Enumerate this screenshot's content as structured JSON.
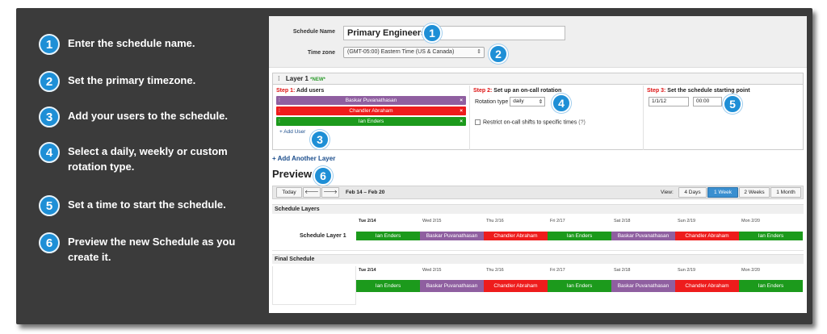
{
  "steps": [
    {
      "n": "1",
      "text": "Enter the schedule name."
    },
    {
      "n": "2",
      "text": "Set the primary timezone."
    },
    {
      "n": "3",
      "text": "Add your users to the schedule."
    },
    {
      "n": "4",
      "text": "Select a daily, weekly or custom rotation type."
    },
    {
      "n": "5",
      "text": "Set a time to start the schedule."
    },
    {
      "n": "6",
      "text": "Preview the new Schedule as you create it."
    }
  ],
  "form": {
    "schedule_name_label": "Schedule Name",
    "schedule_name_value": "Primary Engineers",
    "timezone_label": "Time zone",
    "timezone_value": "(GMT-05:00) Eastern Time (US & Canada)"
  },
  "layer": {
    "title": "Layer 1",
    "new_badge": "*NEW*",
    "step1": {
      "prefix": "Step 1:",
      "title": "Add users"
    },
    "users": [
      {
        "name": "Baskar Puvanathasan",
        "color": "#8f5fa0"
      },
      {
        "name": "Chandler Abraham",
        "color": "#ee1c1c"
      },
      {
        "name": "Ian Enders",
        "color": "#1c9a1c"
      }
    ],
    "remove_symbol": "×",
    "add_user": "+ Add User",
    "step2": {
      "prefix": "Step 2:",
      "title": "Set up an on-call rotation"
    },
    "rotation_label": "Rotation type",
    "rotation_value": "daily",
    "restrict_label": "Restrict on-call shifts to specific times",
    "restrict_help": "(?)",
    "step3": {
      "prefix": "Step 3:",
      "title": "Set the schedule starting point"
    },
    "start_date": "1/1/12",
    "start_time": "00:00"
  },
  "add_layer": "+ Add Another Layer",
  "preview": {
    "title": "Preview",
    "today": "Today",
    "prev": "🡐",
    "next": "🡒",
    "range": "Feb 14 – Feb 20",
    "view_label": "View:",
    "views": [
      "4 Days",
      "1 Week",
      "2 Weeks",
      "1 Month"
    ],
    "active_view": "1 Week",
    "schedule_layers": "Schedule Layers",
    "layer_row_label": "Schedule Layer 1",
    "final_schedule": "Final Schedule",
    "days": [
      "Tue 2/14",
      "Wed 2/15",
      "Thu 2/16",
      "Fri 2/17",
      "Sat 2/18",
      "Sun 2/19",
      "Mon 2/20"
    ],
    "shifts": [
      {
        "name": "Ian Enders",
        "color": "#1c9a1c"
      },
      {
        "name": "Baskar Puvanathasan",
        "color": "#8f5fa0"
      },
      {
        "name": "Chandler Abraham",
        "color": "#ee1c1c"
      },
      {
        "name": "Ian Enders",
        "color": "#1c9a1c"
      },
      {
        "name": "Baskar Puvanathasan",
        "color": "#8f5fa0"
      },
      {
        "name": "Chandler Abraham",
        "color": "#ee1c1c"
      },
      {
        "name": "Ian Enders",
        "color": "#1c9a1c"
      }
    ]
  }
}
